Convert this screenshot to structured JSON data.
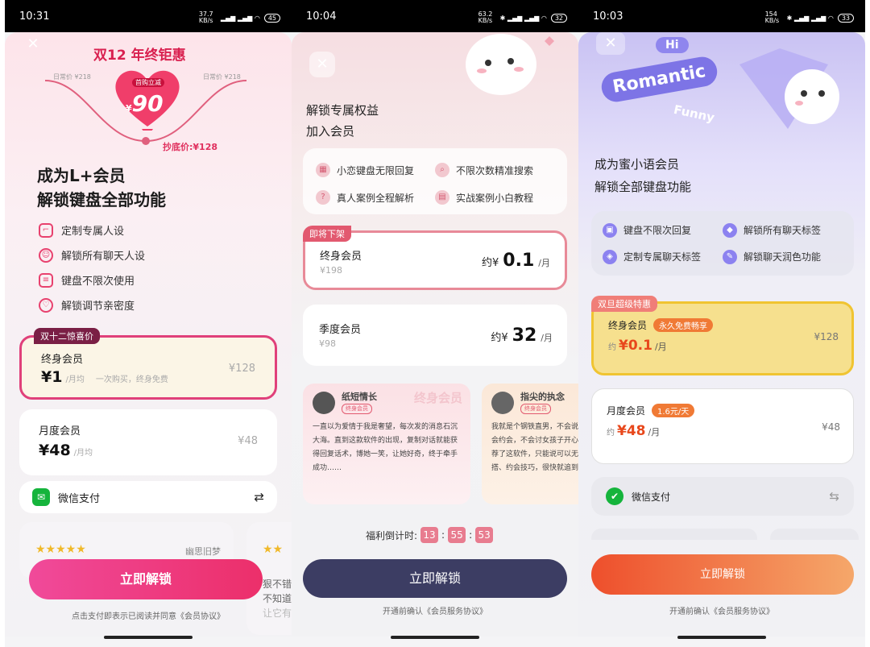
{
  "p1": {
    "status": {
      "time": "10:31",
      "net": "37.7 KB/s",
      "battery": "45"
    },
    "promo": {
      "title": "双12 年终钜惠",
      "badge": "首购立减",
      "price": "90",
      "currency": "¥",
      "left": "日常价 ¥218",
      "right": "日常价 ¥218",
      "floor": "抄底价:¥128"
    },
    "heading": [
      "成为L+会员",
      "解锁键盘全部功能"
    ],
    "features": [
      "定制专属人设",
      "解锁所有聊天人设",
      "键盘不限次使用",
      "解锁调节亲密度"
    ],
    "plan1": {
      "tag": "双十二惊喜价",
      "name": "终身会员",
      "price": "¥1",
      "unit": "/月均",
      "note": "一次购买，终身免费",
      "orig": "¥128"
    },
    "plan2": {
      "name": "月度会员",
      "price": "¥48",
      "unit": "/月均",
      "orig": "¥48"
    },
    "pay": "微信支付",
    "review": {
      "user": "幽思旧梦",
      "side": [
        "狠不错",
        "不知道",
        "让它有"
      ]
    },
    "stars": "★★★★★",
    "cta": "立即解锁",
    "agree": "点击支付即表示已阅读并同意《会员协议》"
  },
  "p2": {
    "status": {
      "time": "10:04",
      "net": "63.2 KB/s",
      "battery": "32"
    },
    "heading": [
      "解锁专属权益",
      "加入会员"
    ],
    "benefits": [
      "小恋键盘无限回复",
      "不限次数精准搜索",
      "真人案例全程解析",
      "实战案例小白教程"
    ],
    "plan1": {
      "tag": "即将下架",
      "name": "终身会员",
      "orig": "¥198",
      "pre": "约¥",
      "price": "0.1",
      "unit": "/月"
    },
    "plan2": {
      "name": "季度会员",
      "orig": "¥98",
      "pre": "约¥",
      "price": "32",
      "unit": "/月"
    },
    "reviews": [
      {
        "user": "纸短情长",
        "badge": "终身会员",
        "tag": "终身会员",
        "text": "一直以为爱情于我是奢望，每次发的消息石沉大海。直到这款软件的出现，复制对话就能获得回复话术，博她一笑，让她好奇，终于牵手成功……"
      },
      {
        "user": "指尖的执念",
        "badge": "终身会员",
        "text": "我就是个钢铁直男，不会说会约会，不会讨女孩子开心荐了这软件，只能说可以无搭、约会技巧，很快就追到"
      }
    ],
    "countdown": {
      "label": "福利倒计时:",
      "h": "13",
      "m": "55",
      "s": "53"
    },
    "cta": "立即解锁",
    "agree": "开通前确认《会员服务协议》"
  },
  "p3": {
    "status": {
      "time": "10:03",
      "net": "154 KB/s",
      "battery": "33"
    },
    "bubbles": {
      "hi": "Hi",
      "romantic": "Romantic",
      "funny": "Funny"
    },
    "heading": [
      "成为蜜小语会员",
      "解锁全部键盘功能"
    ],
    "benefits": [
      "键盘不限次回复",
      "解锁所有聊天标签",
      "定制专属聊天标签",
      "解锁聊天润色功能"
    ],
    "plan1": {
      "tag": "双旦超级特惠",
      "name": "终身会员",
      "pill": "永久免费畅享",
      "pre": "约",
      "price": "¥0.1",
      "unit": "/月",
      "orig": "¥128"
    },
    "plan2": {
      "name": "月度会员",
      "pill": "1.6元/天",
      "pre": "约",
      "price": "¥48",
      "unit": "/月",
      "orig": "¥48"
    },
    "pay": "微信支付",
    "cta": "立即解锁",
    "agree": "开通前确认《会员服务协议》"
  }
}
